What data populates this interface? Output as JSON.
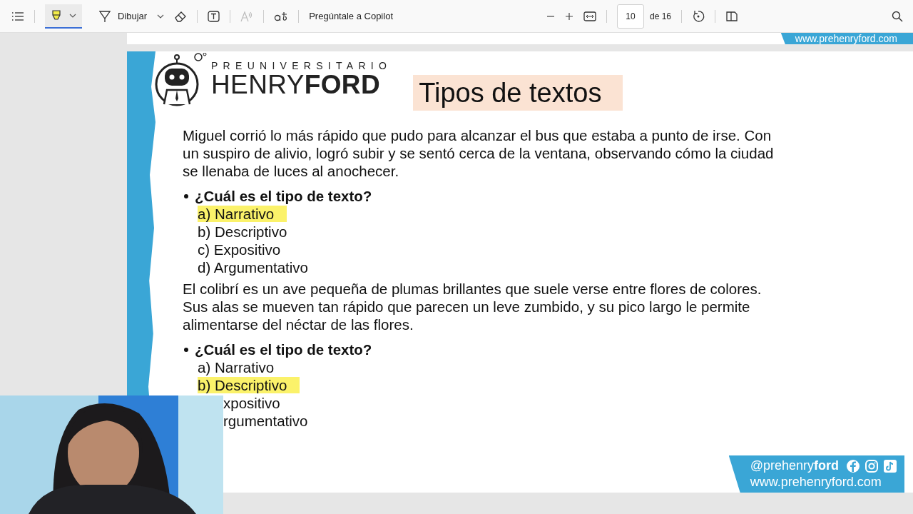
{
  "toolbar": {
    "highlighter": {
      "selected": true
    },
    "draw_label": "Dibujar",
    "read_aloud": {
      "disabled": true
    },
    "copilot_label": "Pregúntale a Copilot",
    "page_number": "10",
    "page_total": "de 16"
  },
  "previous_page": {
    "website": "www.prehenryford.com"
  },
  "page": {
    "logo": {
      "overline": "PREUNIVERSITARIO",
      "name": "HENRY**FORD**"
    },
    "title": "Tipos de textos",
    "sections": [
      {
        "passage": "Miguel corrió lo más rápido que pudo para alcanzar el bus que estaba a punto de irse. Con un suspiro de alivio, logró subir y se sentó cerca de la ventana, observando cómo la ciudad se llenaba de luces al anochecer.",
        "question": "¿Cuál es el tipo de texto?",
        "options": [
          {
            "label": "a) Narrativo",
            "highlighted": true,
            "covered": false
          },
          {
            "label": "b) Descriptivo",
            "highlighted": false,
            "covered": false
          },
          {
            "label": "c) Expositivo",
            "highlighted": false,
            "covered": false
          },
          {
            "label": "d) Argumentativo",
            "highlighted": false,
            "covered": false
          }
        ]
      },
      {
        "passage": "El colibrí es un ave pequeña de plumas brillantes que suele verse entre flores de colores. Sus alas se mueven tan rápido que parecen un leve zumbido, y su pico largo le permite alimentarse del néctar de las flores.",
        "question": "¿Cuál es el tipo de texto?",
        "options": [
          {
            "label": "a) Narrativo",
            "highlighted": false,
            "covered": false
          },
          {
            "label": "b) Descriptivo",
            "highlighted": true,
            "covered": false
          },
          {
            "label": "xpositivo",
            "highlighted": false,
            "covered": true
          },
          {
            "label": "rgumentativo",
            "highlighted": false,
            "covered": true
          }
        ]
      }
    ],
    "footer": {
      "handle": "@prehenry**ford**",
      "website": "www.prehenryford.com"
    }
  }
}
